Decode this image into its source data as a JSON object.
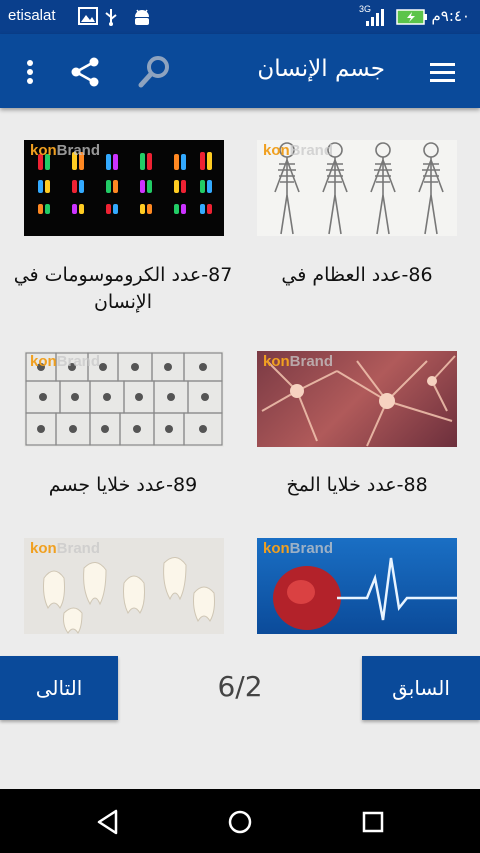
{
  "status_bar": {
    "carrier": "etisalat",
    "network": "3G",
    "time": "٩:٤٠م",
    "icons": [
      "image-icon",
      "usb-icon",
      "android-icon",
      "signal-icon",
      "battery-icon"
    ]
  },
  "app_bar": {
    "title": "جسم الإنسان",
    "icons": [
      "menu-icon",
      "search-icon",
      "share-icon",
      "more-vert-icon"
    ]
  },
  "grid": {
    "brand": {
      "part1": "kon",
      "part2": "Brand"
    },
    "items": [
      {
        "label": "86-عدد العظام في",
        "image": "skeletons"
      },
      {
        "label": "87-عدد الكروموسومات في الإنسان",
        "image": "chromosomes"
      },
      {
        "label": "88-عدد خلايا المخ",
        "image": "neurons"
      },
      {
        "label": "89-عدد خلايا جسم",
        "image": "cells"
      },
      {
        "label": "",
        "image": "heart"
      },
      {
        "label": "",
        "image": "teeth"
      }
    ]
  },
  "pagination": {
    "prev_label": "السابق",
    "next_label": "التالى",
    "page_indicator": "6/2"
  },
  "colors": {
    "primary": "#0a4a9a",
    "status_bar": "#0a3f8c",
    "background": "#ececec"
  }
}
